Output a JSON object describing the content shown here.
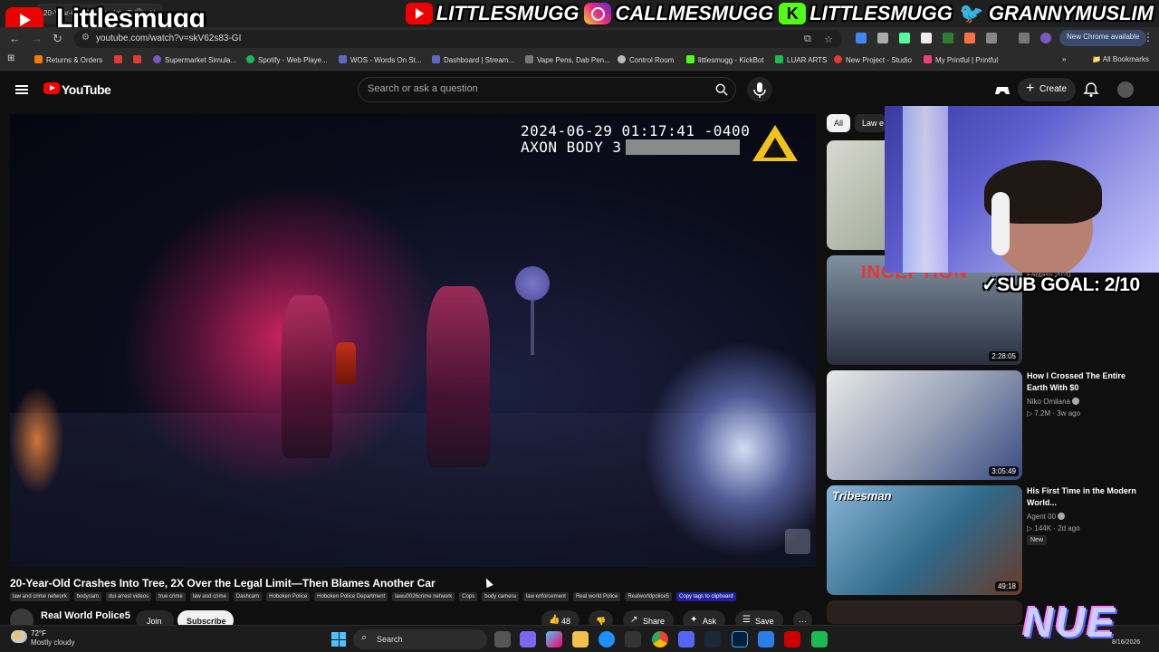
{
  "overlay": {
    "streamer_name": "Littlesmugg",
    "socials": [
      {
        "platform": "youtube",
        "handle": "LITTLESMUGG"
      },
      {
        "platform": "instagram",
        "handle": "CALLMESMUGG"
      },
      {
        "platform": "kick",
        "handle": "LITTLESMUGG"
      },
      {
        "platform": "twitter",
        "handle": "GRANNYMUSLIM"
      }
    ],
    "sub_goal": "SUB GOAL: 2/10",
    "brand_badge": "NUE"
  },
  "browser": {
    "tab_title": "20-Year-Old Crashes Into T",
    "url": "youtube.com/watch?v=skV62s83-GI",
    "new_chrome_label": "New Chrome available",
    "bookmarks": [
      {
        "label": "Returns & Orders",
        "color": "#f57c00"
      },
      {
        "label": "",
        "color": "#e53935"
      },
      {
        "label": "",
        "color": "#e53935"
      },
      {
        "label": "Supermarket Simula...",
        "color": "#7e57c2"
      },
      {
        "label": "Spotify - Web Playe...",
        "color": "#1db954"
      },
      {
        "label": "WOS - Words On St...",
        "color": "#5c6bc0"
      },
      {
        "label": "Dashboard | Stream...",
        "color": "#5c6bc0"
      },
      {
        "label": "Vape Pens, Dab Pen...",
        "color": "#777777"
      },
      {
        "label": "Control Room",
        "color": "#bbbbbb"
      },
      {
        "label": "littlesmugg - KickBot",
        "color": "#53fc18"
      },
      {
        "label": "LUAR ARTS",
        "color": "#1db954"
      },
      {
        "label": "New Project - Studio",
        "color": "#e53935"
      },
      {
        "label": "My Printful | Printful",
        "color": "#ec407a"
      }
    ],
    "all_bookmarks_label": "All Bookmarks"
  },
  "youtube": {
    "wordmark": "YouTube",
    "search_placeholder": "Search or ask a question",
    "create_label": "Create",
    "video": {
      "cam_timestamp": "2024-06-29 01:17:41 -0400",
      "cam_model": "AXON BODY 3",
      "title": "20-Year-Old Crashes Into Tree, 2X Over the Legal Limit—Then Blames Another Car",
      "tags": [
        "law and crime network",
        "bodycam",
        "dui arrest videos",
        "true crime",
        "law and crime",
        "Dashcam",
        "Hoboken Police",
        "Hoboken Police Department",
        "lawu0026crime network",
        "Cops",
        "body camera",
        "law enforcement",
        "Real world Police",
        "Realworldpolice5"
      ],
      "copy_tags_label": "Copy tags to clipboard",
      "channel_name": "Real World Police5",
      "join_label": "Join",
      "subscribe_label": "Subscribe",
      "like_count": "48",
      "share_label": "Share",
      "ask_label": "Ask",
      "save_label": "Save"
    },
    "filters": {
      "active": "All",
      "second": "Law e"
    },
    "recommended": [
      {
        "title": "",
        "channel": "Fantasy 2020",
        "views": "",
        "age": "",
        "duration": "2:28:05",
        "thumb_label": "INCEPTION"
      },
      {
        "title": "How I Crossed The Entire Earth With $0",
        "channel": "Niko Omilana",
        "views": "7.2M",
        "age": "3w ago",
        "duration": "3:05:49"
      },
      {
        "title": "His First Time in the Modern World...",
        "channel": "Agent 00",
        "views": "144K",
        "age": "2d ago",
        "duration": "49:18",
        "badge": "New",
        "thumb_label": "Tribesman"
      }
    ]
  },
  "taskbar": {
    "weather_temp": "72°F",
    "weather_desc": "Mostly cloudy",
    "search_label": "Search",
    "date": "8/16/2026"
  }
}
